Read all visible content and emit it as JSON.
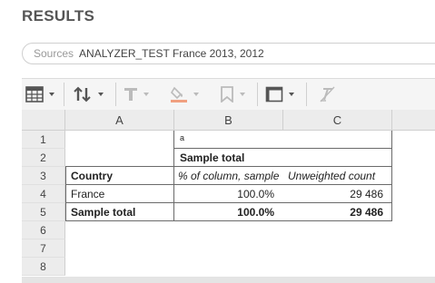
{
  "page": {
    "title": "RESULTS"
  },
  "sources": {
    "label": "Sources",
    "value": "ANALYZER_TEST France 2013, 2012"
  },
  "toolbar": {
    "icons": [
      "table-icon",
      "sort-icon",
      "text-format-icon",
      "fill-color-icon",
      "bookmark-icon",
      "border-icon",
      "clear-format-icon"
    ]
  },
  "grid": {
    "columns": [
      "A",
      "B",
      "C"
    ],
    "rows": [
      "1",
      "2",
      "3",
      "4",
      "5",
      "6",
      "7",
      "8"
    ],
    "cells": {
      "b1": "a",
      "b2": "Sample total",
      "a3": "Country",
      "b3": "% of column, sample",
      "c3": "Unweighted count",
      "a4": "France",
      "b4": "100.0%",
      "c4": "29 486",
      "a5": "Sample total",
      "b5": "100.0%",
      "c5": "29 486"
    }
  },
  "colors": {
    "fill_swatch": "#f0a080",
    "header_bg": "#ececec",
    "toolbar_bg": "#f5f5f5"
  }
}
